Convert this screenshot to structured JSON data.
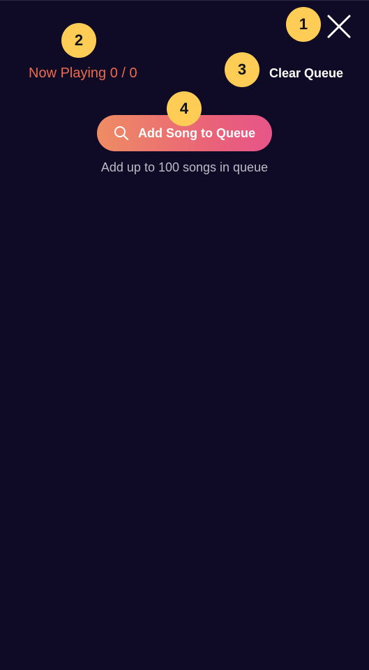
{
  "header": {
    "now_playing": "Now Playing 0 / 0",
    "clear_queue_label": "Clear Queue",
    "close_icon": "close-icon"
  },
  "main": {
    "add_song_label": "Add Song to Queue",
    "add_song_icon": "search-icon",
    "queue_hint": "Add up to 100 songs in queue"
  },
  "annotations": {
    "marker_1": "1",
    "marker_2": "2",
    "marker_3": "3",
    "marker_4": "4"
  },
  "colors": {
    "background": "#0f0a25",
    "now_playing": "#ee6a4c",
    "button_gradient_start": "#ee8c63",
    "button_gradient_end": "#e65689",
    "marker": "#ffcc55",
    "hint_text": "#bdbac8"
  }
}
